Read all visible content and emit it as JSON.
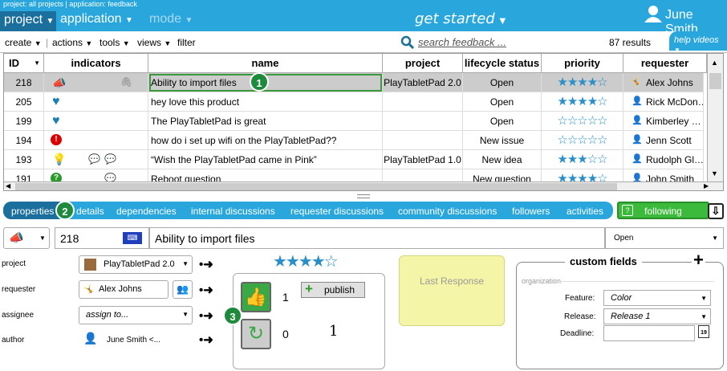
{
  "header": {
    "breadcrumb": "project: all projects  |  application: feedback",
    "nav_project": "project",
    "nav_application": "application",
    "nav_mode": "mode",
    "get_started": "get started",
    "user_name": "June Smith"
  },
  "toolbar": {
    "create": "create",
    "actions": "actions",
    "tools": "tools",
    "views": "views",
    "filter": "filter",
    "search_placeholder": "search feedback ...",
    "results": "87 results",
    "help_videos": "help videos"
  },
  "table": {
    "columns": [
      "ID",
      "indicators",
      "name",
      "project",
      "lifecycle status",
      "priority",
      "requester"
    ],
    "rows": [
      {
        "id": "218",
        "name": "Ability to import files",
        "project": "PlayTabletPad 2.0",
        "status": "Open",
        "priority": "★★★★☆",
        "requester": "Alex Johns"
      },
      {
        "id": "205",
        "name": "hey love this product",
        "project": "",
        "status": "Open",
        "priority": "★★★★☆",
        "requester": "Rick McDon…"
      },
      {
        "id": "199",
        "name": "The PlayTabletPad is great",
        "project": "",
        "status": "Open",
        "priority": "☆☆☆☆☆",
        "requester": "Kimberley …"
      },
      {
        "id": "194",
        "name": "how do i set up wifi on the PlayTabletPad??",
        "project": "",
        "status": "New issue",
        "priority": "☆☆☆☆☆",
        "requester": "Jenn Scott"
      },
      {
        "id": "193",
        "name": "“Wish the PlayTabletPad came in Pink”",
        "project": "PlayTabletPad 1.0",
        "status": "New idea",
        "priority": "★★★☆☆",
        "requester": "Rudolph Gl…"
      },
      {
        "id": "191",
        "name": "Reboot question",
        "project": "",
        "status": "New question",
        "priority": "★★★★☆",
        "requester": "John Smith"
      }
    ]
  },
  "tabs": {
    "properties": "properties",
    "details": "details",
    "dependencies": "dependencies",
    "internal_discussions": "internal discussions",
    "requester_discussions": "requester discussions",
    "community_discussions": "community discussions",
    "followers": "followers",
    "activities": "activities",
    "following": "following"
  },
  "detail": {
    "id": "218",
    "title": "Ability to import files",
    "status": "Open",
    "project_label": "project",
    "project_value": "PlayTabletPad 2.0",
    "requester_label": "requester",
    "requester_value": "Alex Johns",
    "assignee_label": "assignee",
    "assignee_placeholder": "assign to...",
    "author_label": "author",
    "author_value": "June Smith <...",
    "priority": "★★★★☆",
    "votes_up": "1",
    "votes_down": "0",
    "vote_total": "1",
    "publish": "publish",
    "last_response": "Last Response"
  },
  "custom_fields": {
    "title": "custom fields",
    "section": "organization",
    "feature_label": "Feature:",
    "feature_value": "Color",
    "release_label": "Release:",
    "release_value": "Release 1",
    "deadline_label": "Deadline:",
    "deadline_value": ""
  },
  "callouts": {
    "one": "1",
    "two": "2",
    "three": "3"
  }
}
